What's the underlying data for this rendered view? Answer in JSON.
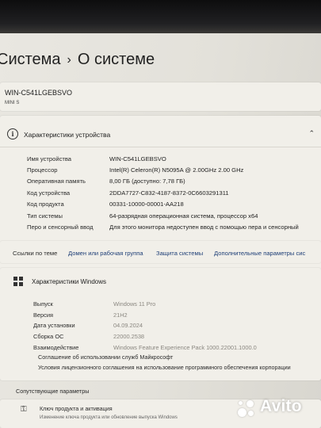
{
  "breadcrumb": {
    "parent": "Система",
    "separator": "›",
    "current": "О системе"
  },
  "device": {
    "name": "WIN-C541LGEBSVO",
    "model": "MINI S"
  },
  "device_specs": {
    "title": "Характеристики устройства",
    "rows": [
      {
        "label": "Имя устройства",
        "value": "WIN-C541LGEBSVO"
      },
      {
        "label": "Процессор",
        "value": "Intel(R) Celeron(R) N5095A @ 2.00GHz   2.00 GHz"
      },
      {
        "label": "Оперативная память",
        "value": "8,00 ГБ (доступно: 7,78 ГБ)"
      },
      {
        "label": "Код устройства",
        "value": "2DDA7727-C832-4187-8372-0C6603291311"
      },
      {
        "label": "Код продукта",
        "value": "00331-10000-00001-AA218"
      },
      {
        "label": "Тип системы",
        "value": "64-разрядная операционная система, процессор x64"
      },
      {
        "label": "Перо и сенсорный ввод",
        "value": "Для этого монитора недоступен ввод с помощью пера и сенсорный"
      }
    ]
  },
  "related_links": {
    "label": "Ссылки по теме",
    "links": [
      "Домен или рабочая группа",
      "Защита системы",
      "Дополнительные параметры сис"
    ]
  },
  "windows_specs": {
    "title": "Характеристики Windows",
    "rows": [
      {
        "label": "Выпуск",
        "value": "Windows 11 Pro"
      },
      {
        "label": "Версия",
        "value": "21H2"
      },
      {
        "label": "Дата установки",
        "value": "04.09.2024"
      },
      {
        "label": "Сборка ОС",
        "value": "22000.2538"
      },
      {
        "label": "Взаимодействие",
        "value": "Windows Feature Experience Pack 1000.22001.1000.0"
      }
    ],
    "links": [
      "Соглашение об использовании служб Майкрософт",
      "Условия лицензионного соглашения на использование программного обеспечения корпорации"
    ]
  },
  "related_settings": {
    "title": "Сопутствующие параметры",
    "items": [
      {
        "title": "Ключ продукта и активация",
        "subtitle": "Изменение ключа продукта или обновление выпуска Windows"
      }
    ]
  },
  "watermark": {
    "brand": "Avito"
  },
  "colors": {
    "link": "#1f3f77",
    "background": "#e6e4dd",
    "card": "#f1efe9"
  },
  "icons": [
    "info-icon",
    "chevron-up-icon",
    "windows-logo-icon",
    "key-icon"
  ]
}
